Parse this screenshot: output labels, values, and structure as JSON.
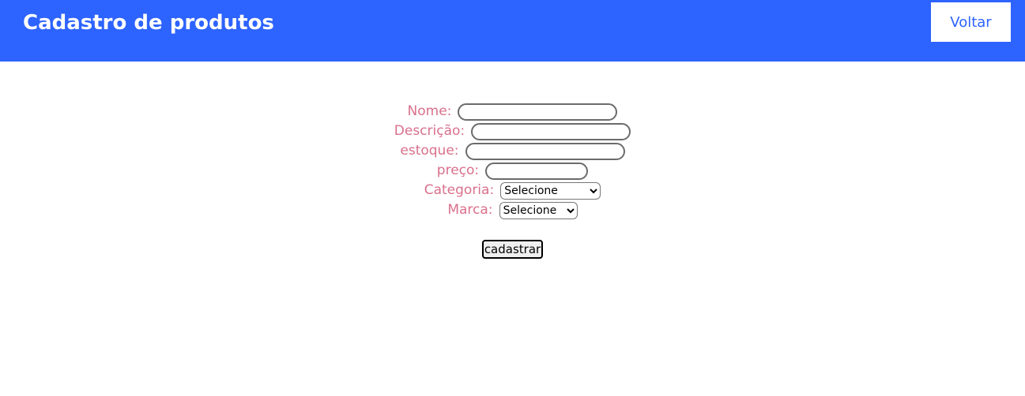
{
  "header": {
    "title": "Cadastro de produtos",
    "back_label": "Voltar"
  },
  "form": {
    "fields": {
      "nome": {
        "label": "Nome:",
        "value": ""
      },
      "descricao": {
        "label": "Descrição:",
        "value": ""
      },
      "estoque": {
        "label": "estoque:",
        "value": ""
      },
      "preco": {
        "label": "preço:",
        "value": ""
      },
      "categoria": {
        "label": "Categoria:",
        "selected": "Selecione"
      },
      "marca": {
        "label": "Marca:",
        "selected": "Selecione"
      }
    },
    "submit_label": "cadastrar"
  },
  "colors": {
    "header_bg": "#2d63ff",
    "label": "#d9708c",
    "header_text": "#ffffff"
  }
}
